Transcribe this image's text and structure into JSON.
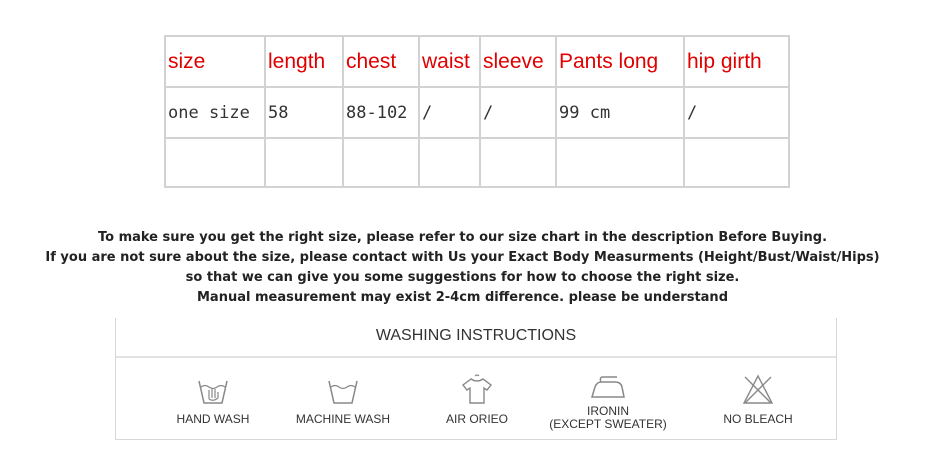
{
  "size_table": {
    "headers": [
      "size",
      "length",
      "chest",
      "waist",
      "sleeve",
      "Pants long",
      "hip girth"
    ],
    "values": [
      "one size",
      "58",
      "88-102",
      "/",
      "/",
      "99 cm",
      "/"
    ]
  },
  "notes": [
    "To make sure you get the right size, please refer to our size chart in the description Before Buying.",
    "If you are not sure about the size, please contact with Us your Exact Body Measurments (Height/Bust/Waist/Hips)",
    "so that we can give you some suggestions for how to choose the right size.",
    "Manual measurement may exist 2-4cm difference. please be understand"
  ],
  "washing": {
    "title": "WASHING INSTRUCTIONS",
    "items": [
      {
        "icon": "hand-wash-icon",
        "label": "HAND WASH"
      },
      {
        "icon": "machine-wash-icon",
        "label": "MACHINE WASH"
      },
      {
        "icon": "air-dry-shirt-icon",
        "label": "AIR ORIEO"
      },
      {
        "icon": "iron-icon",
        "label": "IRONIN",
        "label2": "(EXCEPT SWEATER)"
      },
      {
        "icon": "no-bleach-icon",
        "label": "NO BLEACH"
      }
    ]
  },
  "colors": {
    "header_text": "#e00000",
    "grid": "#d2d2d2"
  }
}
